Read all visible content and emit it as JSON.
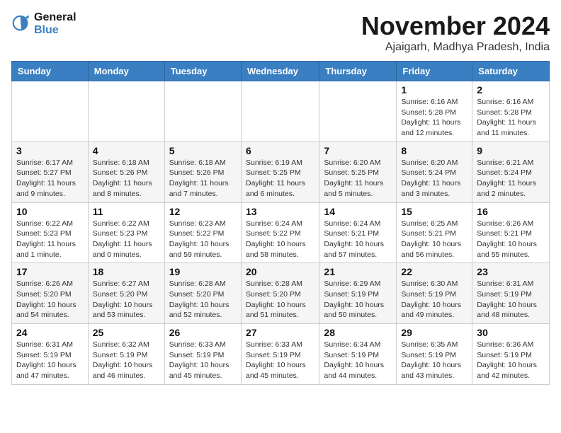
{
  "logo": {
    "line1": "General",
    "line2": "Blue"
  },
  "title": "November 2024",
  "location": "Ajaigarh, Madhya Pradesh, India",
  "headers": [
    "Sunday",
    "Monday",
    "Tuesday",
    "Wednesday",
    "Thursday",
    "Friday",
    "Saturday"
  ],
  "rows": [
    [
      {
        "day": "",
        "detail": ""
      },
      {
        "day": "",
        "detail": ""
      },
      {
        "day": "",
        "detail": ""
      },
      {
        "day": "",
        "detail": ""
      },
      {
        "day": "",
        "detail": ""
      },
      {
        "day": "1",
        "detail": "Sunrise: 6:16 AM\nSunset: 5:28 PM\nDaylight: 11 hours and 12 minutes."
      },
      {
        "day": "2",
        "detail": "Sunrise: 6:16 AM\nSunset: 5:28 PM\nDaylight: 11 hours and 11 minutes."
      }
    ],
    [
      {
        "day": "3",
        "detail": "Sunrise: 6:17 AM\nSunset: 5:27 PM\nDaylight: 11 hours and 9 minutes."
      },
      {
        "day": "4",
        "detail": "Sunrise: 6:18 AM\nSunset: 5:26 PM\nDaylight: 11 hours and 8 minutes."
      },
      {
        "day": "5",
        "detail": "Sunrise: 6:18 AM\nSunset: 5:26 PM\nDaylight: 11 hours and 7 minutes."
      },
      {
        "day": "6",
        "detail": "Sunrise: 6:19 AM\nSunset: 5:25 PM\nDaylight: 11 hours and 6 minutes."
      },
      {
        "day": "7",
        "detail": "Sunrise: 6:20 AM\nSunset: 5:25 PM\nDaylight: 11 hours and 5 minutes."
      },
      {
        "day": "8",
        "detail": "Sunrise: 6:20 AM\nSunset: 5:24 PM\nDaylight: 11 hours and 3 minutes."
      },
      {
        "day": "9",
        "detail": "Sunrise: 6:21 AM\nSunset: 5:24 PM\nDaylight: 11 hours and 2 minutes."
      }
    ],
    [
      {
        "day": "10",
        "detail": "Sunrise: 6:22 AM\nSunset: 5:23 PM\nDaylight: 11 hours and 1 minute."
      },
      {
        "day": "11",
        "detail": "Sunrise: 6:22 AM\nSunset: 5:23 PM\nDaylight: 11 hours and 0 minutes."
      },
      {
        "day": "12",
        "detail": "Sunrise: 6:23 AM\nSunset: 5:22 PM\nDaylight: 10 hours and 59 minutes."
      },
      {
        "day": "13",
        "detail": "Sunrise: 6:24 AM\nSunset: 5:22 PM\nDaylight: 10 hours and 58 minutes."
      },
      {
        "day": "14",
        "detail": "Sunrise: 6:24 AM\nSunset: 5:21 PM\nDaylight: 10 hours and 57 minutes."
      },
      {
        "day": "15",
        "detail": "Sunrise: 6:25 AM\nSunset: 5:21 PM\nDaylight: 10 hours and 56 minutes."
      },
      {
        "day": "16",
        "detail": "Sunrise: 6:26 AM\nSunset: 5:21 PM\nDaylight: 10 hours and 55 minutes."
      }
    ],
    [
      {
        "day": "17",
        "detail": "Sunrise: 6:26 AM\nSunset: 5:20 PM\nDaylight: 10 hours and 54 minutes."
      },
      {
        "day": "18",
        "detail": "Sunrise: 6:27 AM\nSunset: 5:20 PM\nDaylight: 10 hours and 53 minutes."
      },
      {
        "day": "19",
        "detail": "Sunrise: 6:28 AM\nSunset: 5:20 PM\nDaylight: 10 hours and 52 minutes."
      },
      {
        "day": "20",
        "detail": "Sunrise: 6:28 AM\nSunset: 5:20 PM\nDaylight: 10 hours and 51 minutes."
      },
      {
        "day": "21",
        "detail": "Sunrise: 6:29 AM\nSunset: 5:19 PM\nDaylight: 10 hours and 50 minutes."
      },
      {
        "day": "22",
        "detail": "Sunrise: 6:30 AM\nSunset: 5:19 PM\nDaylight: 10 hours and 49 minutes."
      },
      {
        "day": "23",
        "detail": "Sunrise: 6:31 AM\nSunset: 5:19 PM\nDaylight: 10 hours and 48 minutes."
      }
    ],
    [
      {
        "day": "24",
        "detail": "Sunrise: 6:31 AM\nSunset: 5:19 PM\nDaylight: 10 hours and 47 minutes."
      },
      {
        "day": "25",
        "detail": "Sunrise: 6:32 AM\nSunset: 5:19 PM\nDaylight: 10 hours and 46 minutes."
      },
      {
        "day": "26",
        "detail": "Sunrise: 6:33 AM\nSunset: 5:19 PM\nDaylight: 10 hours and 45 minutes."
      },
      {
        "day": "27",
        "detail": "Sunrise: 6:33 AM\nSunset: 5:19 PM\nDaylight: 10 hours and 45 minutes."
      },
      {
        "day": "28",
        "detail": "Sunrise: 6:34 AM\nSunset: 5:19 PM\nDaylight: 10 hours and 44 minutes."
      },
      {
        "day": "29",
        "detail": "Sunrise: 6:35 AM\nSunset: 5:19 PM\nDaylight: 10 hours and 43 minutes."
      },
      {
        "day": "30",
        "detail": "Sunrise: 6:36 AM\nSunset: 5:19 PM\nDaylight: 10 hours and 42 minutes."
      }
    ]
  ]
}
